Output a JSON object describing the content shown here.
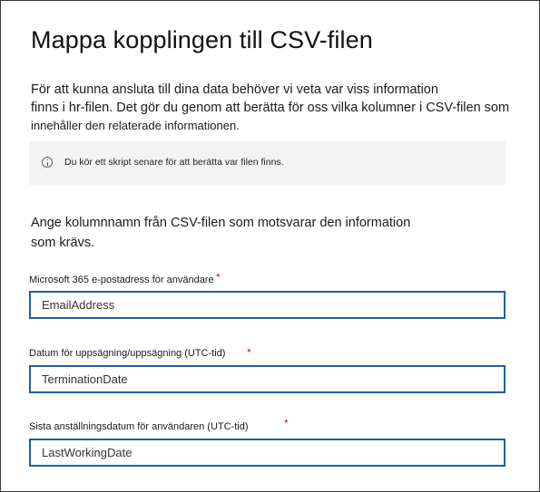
{
  "dialog": {
    "title": "Mappa kopplingen till CSV-filen",
    "intro_lines": [
      "För att kunna ansluta till dina data behöver vi veta var viss information",
      "finns i hr-filen. Det gör du genom att berätta för oss vilka kolumner i CSV-filen som",
      "innehåller den relaterade informationen."
    ],
    "info_box": {
      "icon": "info-icon",
      "text": "Du kör ett skript senare för att berätta var filen finns."
    },
    "instruction_lines": [
      "Ange kolumnnamn från CSV-filen som motsvarar den information",
      "som krävs."
    ],
    "fields": [
      {
        "label": "Microsoft 365 e-postadress för användare",
        "required_marker": "*",
        "value": "EmailAddress"
      },
      {
        "label": "Datum för uppsägning/uppsägning (UTC-tid)",
        "required_marker": "*",
        "value": "TerminationDate"
      },
      {
        "label": "Sista anställningsdatum för användaren (UTC-tid)",
        "required_marker": "*",
        "value": "LastWorkingDate"
      }
    ],
    "colors": {
      "input_border": "#1f5fa6",
      "required": "#c50f1f",
      "info_background": "#f3f3f3"
    }
  }
}
